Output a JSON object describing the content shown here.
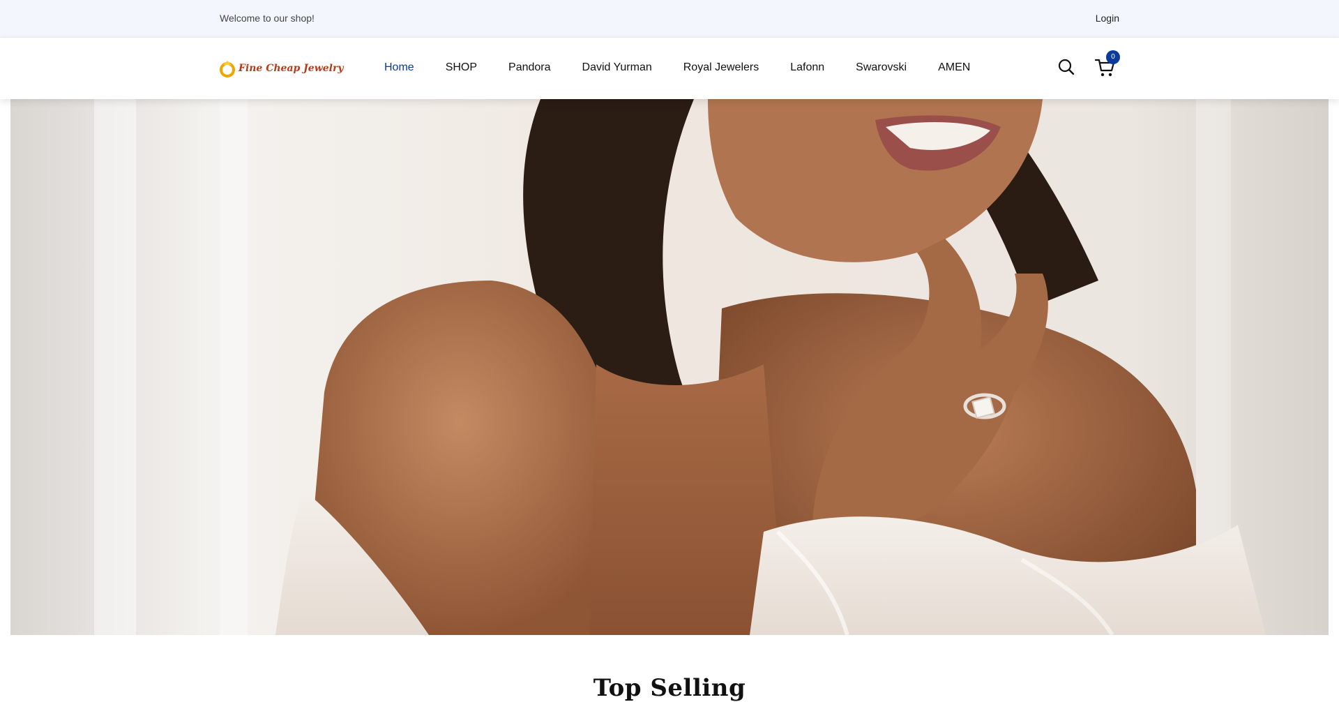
{
  "topbar": {
    "welcome_text": "Welcome to our shop!",
    "login_label": "Login"
  },
  "header": {
    "logo_text": "Fine Cheap Jewelry",
    "nav": [
      {
        "label": "Home",
        "active": true
      },
      {
        "label": "SHOP"
      },
      {
        "label": "Pandora"
      },
      {
        "label": "David Yurman"
      },
      {
        "label": "Royal Jewelers"
      },
      {
        "label": "Lafonn"
      },
      {
        "label": "Swarovski"
      },
      {
        "label": "AMEN"
      }
    ],
    "search_icon": "search-icon",
    "cart_icon": "cart-icon",
    "cart_count": "0"
  },
  "hero": {
    "image_subject": "woman in white lace off-shoulder dress wearing diamond ring"
  },
  "sections": {
    "top_selling_title": "Top Selling"
  },
  "colors": {
    "accent": "#0a3a9a",
    "topbar_bg": "#f3f6fc",
    "logo_text": "#b83a1a"
  }
}
